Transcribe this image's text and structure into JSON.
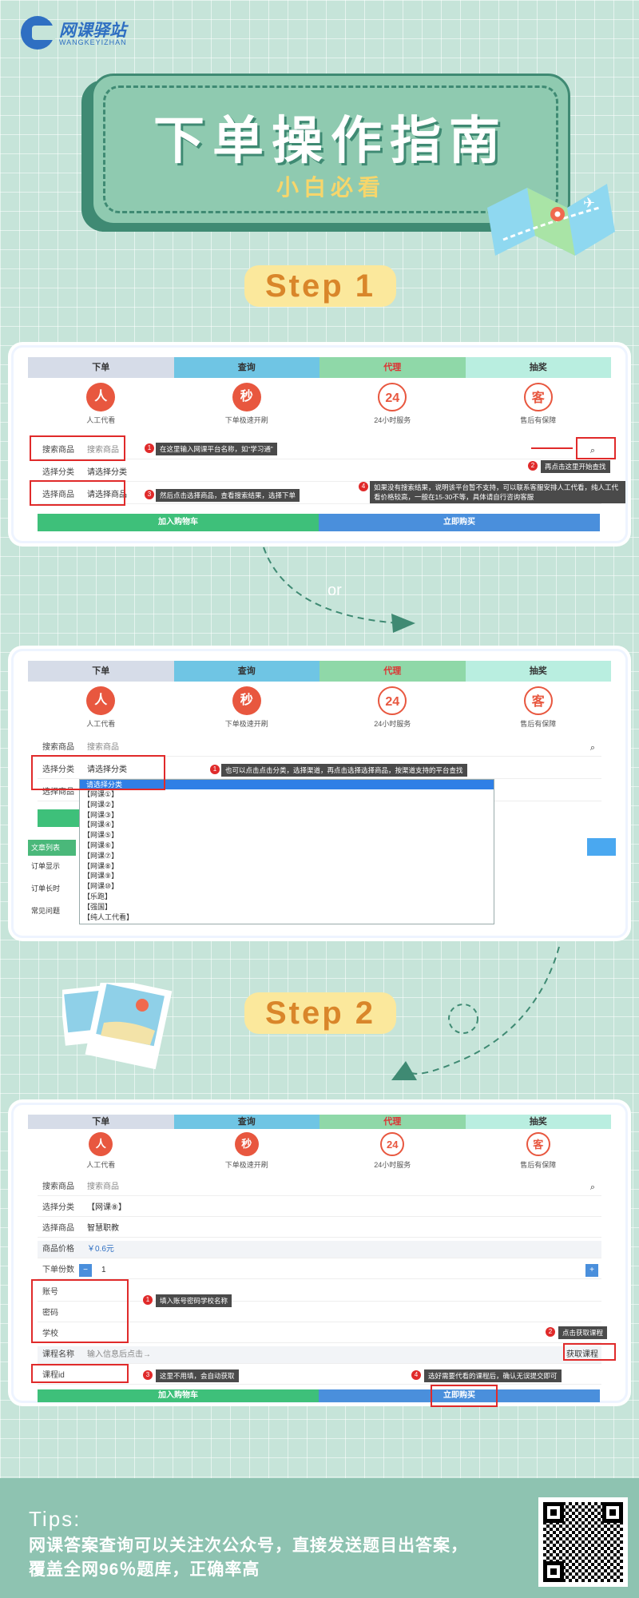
{
  "brand": {
    "name": "网课驿站",
    "pinyin": "WANGKEYIZHAN"
  },
  "title": {
    "main": "下单操作指南",
    "sub": "小白必看"
  },
  "steps": {
    "step1": "Step 1",
    "step2": "Step 2",
    "or": "or"
  },
  "tabs": [
    "下单",
    "查询",
    "代理",
    "抽奖"
  ],
  "services": [
    "人工代看",
    "下单极速开刷",
    "24小时服务",
    "售后有保障"
  ],
  "service_glyphs": [
    "人",
    "秒",
    "24",
    "客"
  ],
  "card1": {
    "search_label": "搜索商品",
    "search_placeholder": "搜索商品",
    "category_label": "选择分类",
    "category_value": "请选择分类",
    "product_label": "选择商品",
    "product_value": "请选择商品",
    "add_cart": "加入购物车",
    "buy_now": "立即购买",
    "tip1": "在这里输入网课平台名称，如“学习通”",
    "tip2": "再点击这里开始查找",
    "tip3": "然后点击选择商品，查看搜索结果，选择下单",
    "tip4": "如果没有搜索结果，说明该平台暂不支持，可以联系客服安排人工代看，纯人工代看价格较高，一般在15-30不等，具体请自行咨询客服"
  },
  "card2": {
    "search_label": "搜索商品",
    "search_placeholder": "搜索商品",
    "category_label": "选择分类",
    "category_value": "请选择分类",
    "product_label": "选择商品",
    "tip1": "也可以点击点击分类，选择渠道，再点击选择选择商品，按渠道支持的平台查找",
    "dropdown": [
      "请选择分类",
      "【网课①】",
      "【网课②】",
      "【网课③】",
      "【网课④】",
      "【网课⑤】",
      "【网课⑥】",
      "【网课⑦】",
      "【网课⑧】",
      "【网课⑨】",
      "【网课⑩】",
      "【乐跑】",
      "【强国】",
      "【纯人工代看】"
    ],
    "articles": [
      "文章列表",
      "订单显示",
      "订单长时",
      "常见问题"
    ]
  },
  "card3": {
    "search_label": "搜索商品",
    "search_placeholder": "搜索商品",
    "category_label": "选择分类",
    "category_value": "【网课⑧】",
    "product_label": "选择商品",
    "product_value": "智慧职教",
    "price_label": "商品价格",
    "price_value": "￥0.6元",
    "qty_label": "下单份数",
    "qty_value": "1",
    "account_label": "账号",
    "password_label": "密码",
    "school_label": "学校",
    "course_name_label": "课程名称",
    "course_name_placeholder": "输入信息后点击→",
    "get_course": "获取课程",
    "course_id_label": "课程id",
    "add_cart": "加入购物车",
    "buy_now": "立即购买",
    "tip1": "填入账号密码学校名称",
    "tip2": "点击获取课程",
    "tip3": "这里不用填，会自动获取",
    "tip4": "选好需要代看的课程后，确认无误提交即可"
  },
  "footer": {
    "tips_title": "Tips:",
    "line1": "网课答案查询可以关注次公众号，直接发送题目出答案，",
    "line2": "覆盖全网96％题库，正确率高"
  },
  "colors": {
    "accent_red": "#e02a2a",
    "green": "#3ec07a",
    "blue": "#4a8fdc",
    "bg": "#c6e4d9"
  }
}
